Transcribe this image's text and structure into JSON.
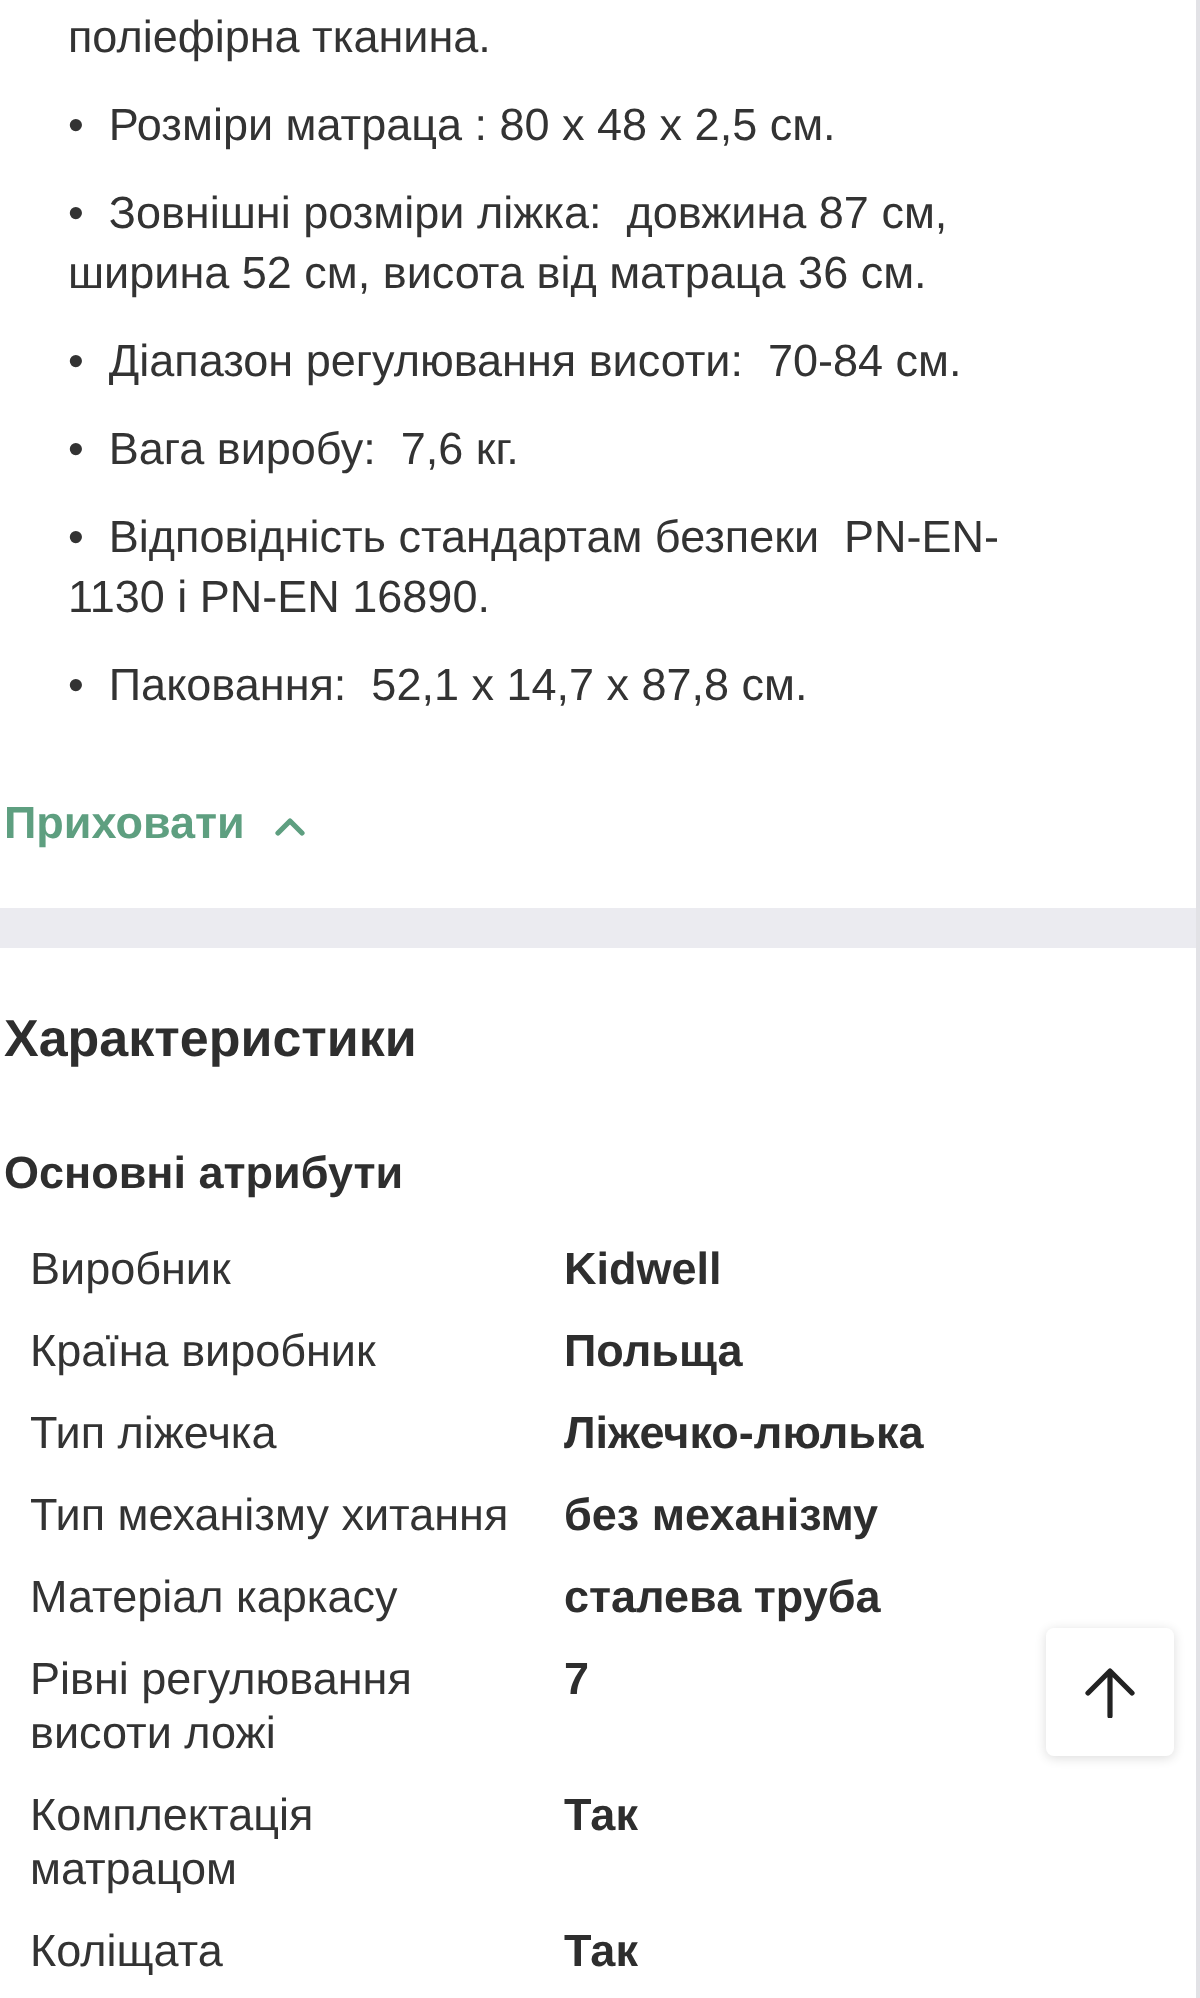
{
  "description": {
    "continued_text": "поліефірна тканина.",
    "bullets": [
      "•  Розміри матраца : 80 х 48 х 2,5 см.",
      "•  Зовнішні розміри ліжка:  довжина 87 см, ширина 52 см, висота від матраца 36 см.",
      "•  Діапазон регулювання висоти:  70-84 см.",
      "•  Вага виробу:  7,6 кг.",
      "•  Відповідність стандартам безпеки  PN-EN-1130 і PN-EN 16890.",
      "•  Паковання:  52,1 x 14,7 x 87,8 см."
    ]
  },
  "toggle_link": {
    "label": "Приховати",
    "expanded": true
  },
  "characteristics": {
    "title": "Характеристики",
    "group_title": "Основні атрибути",
    "rows": [
      {
        "label": "Виробник",
        "value": "Kidwell"
      },
      {
        "label": "Країна виробник",
        "value": "Польща"
      },
      {
        "label": "Тип ліжечка",
        "value": "Ліжечко-люлька"
      },
      {
        "label": "Тип механізму хитання",
        "value": "без механізму"
      },
      {
        "label": "Матеріал каркасу",
        "value": "сталева труба"
      },
      {
        "label": "Рівні регулювання висоти ложі",
        "value": "7"
      },
      {
        "label": "Комплектація матрацом",
        "value": "Так"
      },
      {
        "label": "Коліщата",
        "value": "Так"
      }
    ]
  }
}
